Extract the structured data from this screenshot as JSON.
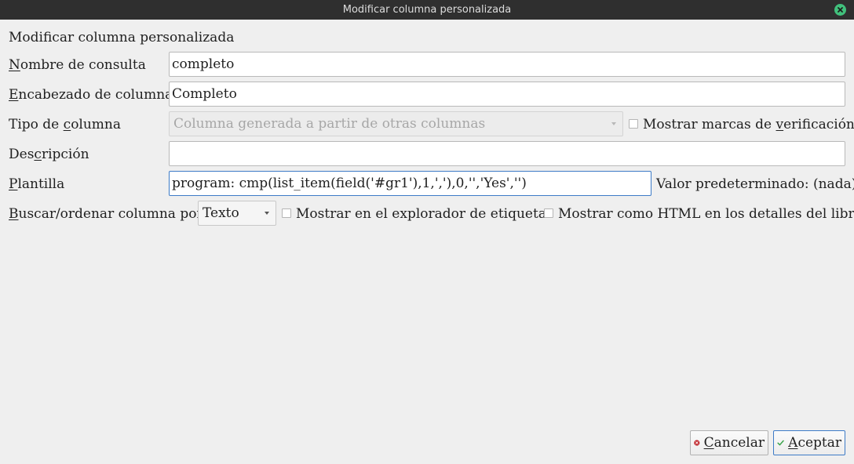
{
  "window": {
    "title": "Modificar columna personalizada"
  },
  "heading": "Modificar columna personalizada",
  "form": {
    "lookup_name": {
      "label_u": "N",
      "label_rest": "ombre de consulta",
      "value": "completo"
    },
    "column_heading": {
      "label_u": "E",
      "label_rest": "ncabezado de columna",
      "value": "Completo"
    },
    "column_type": {
      "label_pre": "Tipo de ",
      "label_u": "c",
      "label_rest": "olumna",
      "selected": "Columna generada a partir de otras columnas"
    },
    "show_checkmarks": {
      "label_pre": "Mostrar marcas de ",
      "label_u": "v",
      "label_rest": "erificación",
      "checked": false
    },
    "description": {
      "label_pre": "Des",
      "label_u": "c",
      "label_rest": "ripción",
      "value": ""
    },
    "template": {
      "label_u": "P",
      "label_rest": "lantilla",
      "value": "program: cmp(list_item(field('#gr1'),1,','),0,'','Yes','')",
      "default_value": "Valor predeterminado: (nada)"
    },
    "sort_by": {
      "label_u": "B",
      "label_rest": "uscar/ordenar columna por",
      "selected": "Texto"
    },
    "show_in_tag_browser": {
      "label": "Mostrar en el explorador de etiquetas",
      "checked": false
    },
    "show_as_html": {
      "label": "Mostrar como HTML en los detalles del libro",
      "checked": false
    }
  },
  "buttons": {
    "cancel": {
      "label_u": "C",
      "label_rest": "ancelar"
    },
    "ok": {
      "label_u": "A",
      "label_rest": "ceptar"
    }
  },
  "colors": {
    "titlebar": "#2f2f2f",
    "close": "#41c07c",
    "focus": "#3d7bc7",
    "cancel_icon": "#c0272d",
    "ok_icon": "#3aa44a"
  }
}
